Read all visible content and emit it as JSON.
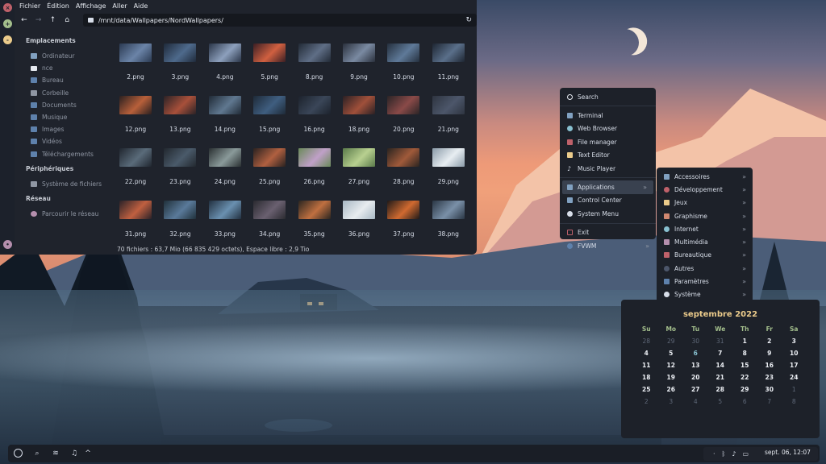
{
  "menubar": [
    "Fichier",
    "Édition",
    "Affichage",
    "Aller",
    "Aide"
  ],
  "toolbar": {
    "path": "/mnt/data/Wallpapers/NordWallpapers/",
    "icons": [
      "back-icon",
      "forward-icon",
      "up-icon",
      "home-icon",
      "folder-icon",
      "refresh-icon"
    ]
  },
  "sidebar": {
    "places_title": "Emplacements",
    "places": [
      "Ordinateur",
      "nce",
      "Bureau",
      "Corbeille",
      "Documents",
      "Musique",
      "Images",
      "Vidéos",
      "Téléchargements"
    ],
    "devices_title": "Périphériques",
    "devices": [
      "Système de fichiers"
    ],
    "network_title": "Réseau",
    "network": [
      "Parcourir le réseau"
    ]
  },
  "files": [
    "2.png",
    "3.png",
    "4.png",
    "5.png",
    "8.png",
    "9.png",
    "10.png",
    "11.png",
    "12.png",
    "13.png",
    "14.png",
    "15.png",
    "16.png",
    "18.png",
    "20.png",
    "21.png",
    "22.png",
    "23.png",
    "24.png",
    "25.png",
    "26.png",
    "27.png",
    "28.png",
    "29.png",
    "31.png",
    "32.png",
    "33.png",
    "34.png",
    "35.png",
    "36.png",
    "37.png",
    "38.png"
  ],
  "status": "70 fichiers : 63,7 Mio (66 835 429 octets), Espace libre : 2,9 Tio",
  "menu": {
    "items": [
      "Search",
      "Terminal",
      "Web Browser",
      "File manager",
      "Text Editor",
      "Music Player",
      "Applications",
      "Control Center",
      "System Menu",
      "Exit",
      "FVWM"
    ],
    "submenu": [
      "Accessoires",
      "Développement",
      "Jeux",
      "Graphisme",
      "Internet",
      "Multimédia",
      "Bureautique",
      "Autres",
      "Paramètres",
      "Système"
    ]
  },
  "calendar": {
    "title": "septembre 2022",
    "weekdays": [
      "Su",
      "Mo",
      "Tu",
      "We",
      "Th",
      "Fr",
      "Sa"
    ],
    "weeks": [
      [
        "28",
        "29",
        "30",
        "31",
        "1",
        "2",
        "3"
      ],
      [
        "4",
        "5",
        "6",
        "7",
        "8",
        "9",
        "10"
      ],
      [
        "11",
        "12",
        "13",
        "14",
        "15",
        "16",
        "17"
      ],
      [
        "18",
        "19",
        "20",
        "21",
        "22",
        "23",
        "24"
      ],
      [
        "25",
        "26",
        "27",
        "28",
        "29",
        "30",
        "1"
      ],
      [
        "2",
        "3",
        "4",
        "5",
        "6",
        "7",
        "8"
      ]
    ],
    "today": "6"
  },
  "panel": {
    "clock": "sept. 06, 12:07",
    "buttons": [
      "circle-icon",
      "search-icon",
      "layers-icon",
      "bell-icon",
      "chevron-up-icon"
    ],
    "tray": [
      "bluetooth-icon",
      "volume-icon",
      "battery-icon"
    ]
  },
  "colors": {
    "accent": "#88c0d0",
    "calendar_title": "#ebcb8b",
    "weekday": "#a3be8c"
  }
}
